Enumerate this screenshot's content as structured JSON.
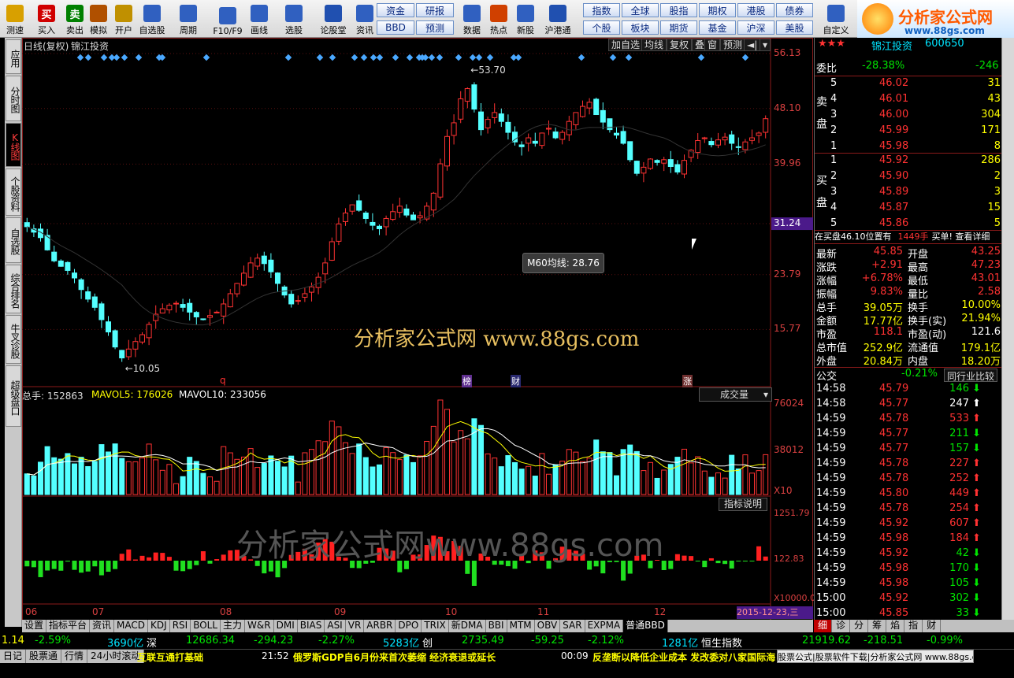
{
  "toolbar": {
    "buttons": [
      {
        "label": "测速",
        "icon": "speed-icon",
        "color": "#d8a000"
      },
      {
        "label": "买入",
        "icon": "buy-icon",
        "color": "#d00000",
        "glyph": "买"
      },
      {
        "label": "卖出",
        "icon": "sell-icon",
        "color": "#008000",
        "glyph": "卖"
      },
      {
        "label": "模拟",
        "icon": "hammer-icon",
        "color": "#b05000"
      },
      {
        "label": "开户",
        "icon": "lock-icon",
        "color": "#c09000"
      },
      {
        "label": "自选股",
        "icon": "star-icon",
        "color": "#3060c0"
      },
      {
        "label": "周期",
        "icon": "clock-icon",
        "color": "#3060c0"
      },
      {
        "label": "F10/F9",
        "icon": "document-icon",
        "color": "#3060c0"
      },
      {
        "label": "画线",
        "icon": "pen-icon",
        "color": "#3060c0"
      },
      {
        "label": "选股",
        "icon": "chart-icon",
        "color": "#3060c0"
      },
      {
        "label": "论股堂",
        "icon": "talk-icon",
        "color": "#2050b0"
      },
      {
        "label": "资讯",
        "icon": "news-icon",
        "color": "#3060c0"
      },
      {
        "label": "数据",
        "icon": "pe-icon",
        "color": "#3060c0"
      },
      {
        "label": "热点",
        "icon": "fire-icon",
        "color": "#d04000"
      },
      {
        "label": "新股",
        "icon": "new-stock-icon",
        "color": "#3060c0"
      },
      {
        "label": "沪港通",
        "icon": "sse-hkex-icon",
        "color": "#2050b0"
      },
      {
        "label": "自定义",
        "icon": "custom-icon",
        "color": "#3060c0"
      }
    ],
    "blue_buttons": [
      "资金",
      "研报",
      "BBD",
      "预测"
    ],
    "market_buttons": [
      "指数",
      "全球",
      "股指",
      "期权",
      "港股",
      "债券",
      "个股",
      "板块",
      "期货",
      "基金",
      "沪深",
      "美股"
    ],
    "logo_text": "分析家公式网",
    "logo_url": "www.88gs.com"
  },
  "left_tabs": [
    "应用",
    "分时图",
    "K线图",
    "个股资料",
    "自选股",
    "综合排名",
    "牛叉诊股",
    "超级盘口"
  ],
  "chart": {
    "title": "日线(复权)",
    "stock_name": "锦江投资",
    "tool_buttons": [
      "加自选",
      "均线",
      "复权",
      "叠",
      "窗",
      "预测",
      "◄|"
    ],
    "price_axis": [
      "56.13",
      "48.10",
      "39.96",
      "31.24",
      "23.79",
      "15.77"
    ],
    "high_label": "53.70",
    "low_label": "10.05",
    "tooltip": "M60均线: 28.76",
    "watermark1": "分析家公式网 www.88gs.com",
    "watermark2": "分析家公式网www.88gs.com",
    "markers": [
      "q",
      "榜",
      "财",
      "涨"
    ],
    "vol_title": "总手: 152863",
    "vol_ma5": "MAVOL5: 176026",
    "vol_ma10": "MAVOL10: 233056",
    "vol_dropdown": "成交量",
    "vol_axis": [
      "76024",
      "38012",
      "X10"
    ],
    "indicator_btn": "指标说明",
    "macd_axis": [
      "1251.79",
      "122.83",
      "X10000.0"
    ],
    "date_labels": [
      "06",
      "07",
      "08",
      "09",
      "10",
      "11",
      "12"
    ],
    "date_current": "2015-12-23,三"
  },
  "chart_data": {
    "type": "candlestick",
    "ylim": [
      10.05,
      56.13
    ],
    "series": [
      {
        "values": [
          30.8,
          30.0,
          29.2,
          27.4,
          25.8,
          25.0,
          24.4,
          23.3,
          21.6,
          20.2,
          19.0,
          17.2,
          15.4,
          13.2,
          11.6,
          12.9,
          14.0,
          15.0,
          16.5,
          18.0,
          18.8,
          19.3,
          19.6,
          19.0,
          18.3,
          17.6,
          17.3,
          17.8,
          18.3,
          19.5,
          21.0,
          22.5,
          24.0,
          25.5,
          26.2,
          25.4,
          24.2,
          22.5,
          20.8,
          19.5,
          20.0,
          21.0,
          22.0,
          23.4,
          25.5,
          28.6,
          31.2,
          32.8,
          34.0,
          33.2,
          32.0,
          31.0,
          30.5,
          32.0,
          33.0,
          33.8,
          32.5,
          31.8,
          32.4,
          33.8,
          35.7,
          40.0,
          44.0,
          46.0,
          49.5,
          51.0,
          48.0,
          45.0,
          46.5,
          47.5,
          46.2,
          44.6,
          43.2,
          42.5,
          43.8,
          43.0,
          44.5,
          45.2,
          43.8,
          44.6,
          46.2,
          47.5,
          48.4,
          49.0,
          47.2,
          46.1,
          45.0,
          44.2,
          43.0,
          40.6,
          38.6,
          39.5,
          40.7,
          40.2,
          40.6,
          39.6,
          38.8,
          40.5,
          42.0,
          43.4,
          43.8,
          42.8,
          43.5,
          43.9,
          43.0,
          42.4,
          43.2,
          43.8,
          44.5,
          46.6
        ]
      }
    ]
  },
  "quote": {
    "header_name": "锦江投资",
    "header_code": "600650",
    "wb_label": "委比",
    "wb_value": "-28.38%",
    "wb_diff": "-246",
    "sell_label": "卖盘",
    "buy_label": "买盘",
    "sells": [
      {
        "n": "5",
        "p": "46.02",
        "v": "31"
      },
      {
        "n": "4",
        "p": "46.01",
        "v": "43"
      },
      {
        "n": "3",
        "p": "46.00",
        "v": "304"
      },
      {
        "n": "2",
        "p": "45.99",
        "v": "171"
      },
      {
        "n": "1",
        "p": "45.98",
        "v": "8"
      }
    ],
    "buys": [
      {
        "n": "1",
        "p": "45.92",
        "v": "286"
      },
      {
        "n": "2",
        "p": "45.90",
        "v": "2"
      },
      {
        "n": "3",
        "p": "45.89",
        "v": "3"
      },
      {
        "n": "4",
        "p": "45.87",
        "v": "15"
      },
      {
        "n": "5",
        "p": "45.86",
        "v": "5"
      }
    ],
    "notice": "在买盘46.10位置有",
    "notice_vol": "1449手",
    "notice_tail": "买单! 查看详细",
    "stats": [
      {
        "l1": "最新",
        "v1": "45.85",
        "l2": "开盘",
        "v2": "43.25"
      },
      {
        "l1": "涨跌",
        "v1": "+2.91",
        "l2": "最高",
        "v2": "47.23"
      },
      {
        "l1": "涨幅",
        "v1": "+6.78%",
        "l2": "最低",
        "v2": "43.01"
      },
      {
        "l1": "振幅",
        "v1": "9.83%",
        "l2": "量比",
        "v2": "2.58"
      },
      {
        "l1": "总手",
        "v1": "39.05万",
        "l2": "换手",
        "v2": "10.00%"
      },
      {
        "l1": "金额",
        "v1": "17.77亿",
        "l2": "换手(实)",
        "v2": "21.94%"
      },
      {
        "l1": "市盈",
        "v1": "118.1",
        "l2": "市盈(动)",
        "v2": "121.6"
      },
      {
        "l1": "总市值",
        "v1": "252.9亿",
        "l2": "流通值",
        "v2": "179.1亿"
      },
      {
        "l1": "外盘",
        "v1": "20.84万",
        "l2": "内盘",
        "v2": "18.20万"
      }
    ],
    "gj_label": "公交",
    "gj_value": "-0.21%",
    "gj_btn": "同行业比较",
    "ticks": [
      {
        "t": "14:58",
        "p": "45.79",
        "v": "146",
        "d": "down"
      },
      {
        "t": "14:58",
        "p": "45.77",
        "v": "247",
        "d": "up-white"
      },
      {
        "t": "14:59",
        "p": "45.78",
        "v": "533",
        "d": "up"
      },
      {
        "t": "14:59",
        "p": "45.77",
        "v": "211",
        "d": "down"
      },
      {
        "t": "14:59",
        "p": "45.77",
        "v": "157",
        "d": "down"
      },
      {
        "t": "14:59",
        "p": "45.78",
        "v": "227",
        "d": "up"
      },
      {
        "t": "14:59",
        "p": "45.78",
        "v": "252",
        "d": "up"
      },
      {
        "t": "14:59",
        "p": "45.80",
        "v": "449",
        "d": "up"
      },
      {
        "t": "14:59",
        "p": "45.78",
        "v": "254",
        "d": "up"
      },
      {
        "t": "14:59",
        "p": "45.92",
        "v": "607",
        "d": "up"
      },
      {
        "t": "14:59",
        "p": "45.98",
        "v": "184",
        "d": "up"
      },
      {
        "t": "14:59",
        "p": "45.92",
        "v": "42",
        "d": "down"
      },
      {
        "t": "14:59",
        "p": "45.98",
        "v": "170",
        "d": "down"
      },
      {
        "t": "14:59",
        "p": "45.98",
        "v": "105",
        "d": "down"
      },
      {
        "t": "15:00",
        "p": "45.92",
        "v": "302",
        "d": "down"
      },
      {
        "t": "15:00",
        "p": "45.85",
        "v": "33",
        "d": "down"
      }
    ],
    "bottom_tabs": [
      "细",
      "诊",
      "分",
      "筹",
      "焰",
      "指",
      "财"
    ]
  },
  "indicator_tabs": [
    "设置",
    "指标平台",
    "资讯",
    "MACD",
    "KDJ",
    "RSI",
    "BOLL",
    "主力",
    "W&R",
    "DMI",
    "BIAS",
    "ASI",
    "VR",
    "ARBR",
    "DPO",
    "TRIX",
    "新DMA",
    "BBI",
    "MTM",
    "OBV",
    "SAR",
    "EXPMA",
    "普通BBD"
  ],
  "status": {
    "s1": "1.14",
    "s2": "-2.59%",
    "s3": "3690亿",
    "s4": "深",
    "s5": "12686.34",
    "s6": "-294.23",
    "s7": "-2.27%",
    "s8": "5283亿",
    "s9": "创",
    "s10": "2735.49",
    "s11": "-59.25",
    "s12": "-2.12%",
    "s13": "1281亿",
    "s14": "恒生指数",
    "s15": "21919.62",
    "s16": "-218.51",
    "s17": "-0.99%"
  },
  "ticker": {
    "tabs": [
      "日记",
      "股票通",
      "行情",
      "24小时滚动"
    ],
    "news1": "互联互通打基础",
    "news2_time": "21:52",
    "news2": "俄罗斯GDP自6月份来首次萎缩 经济衰退或延长",
    "news3_time": "00:09",
    "news3": "反垄断以降低企业成本 发改委对八家国际海",
    "footer": "股票公式|股票软件下载|分析家公式网 www.88gs.com"
  }
}
